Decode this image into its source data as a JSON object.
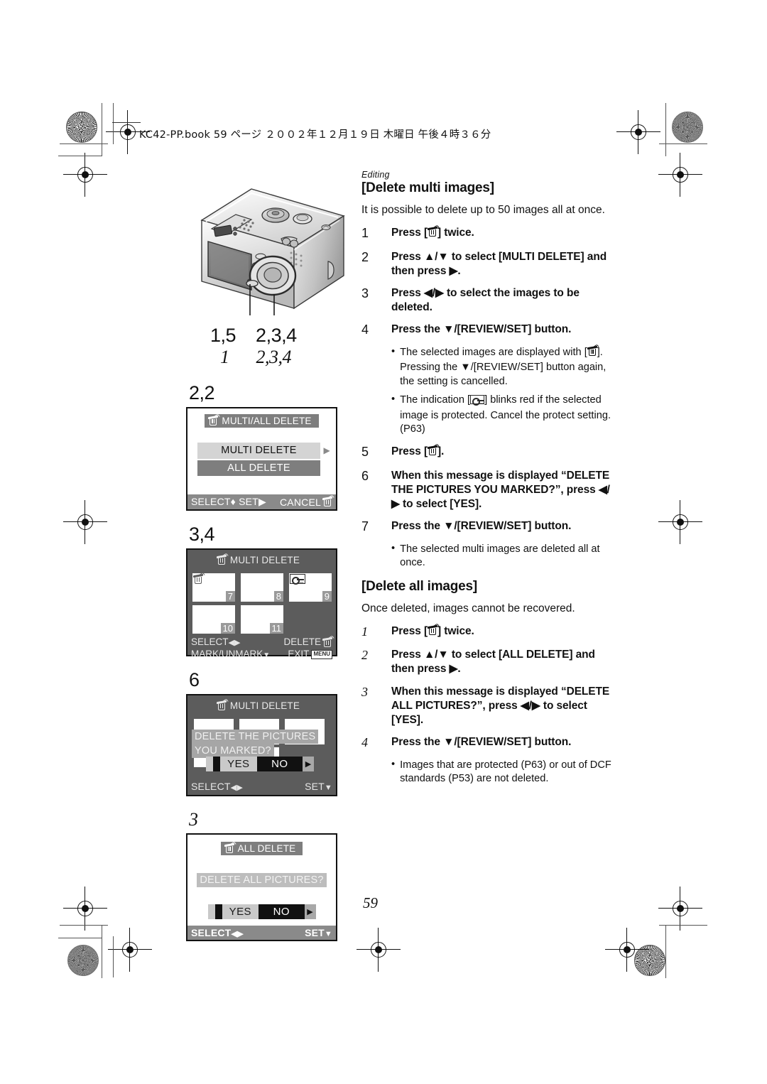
{
  "header": {
    "book_line": "KC42-PP.book  59 ページ  ２００２年１２月１９日  木曜日  午後４時３６分"
  },
  "page_number": "59",
  "left_column": {
    "camera_callouts": {
      "row1": [
        "1,5",
        "2,3,4"
      ],
      "row2": [
        "1",
        "2,3,4"
      ]
    },
    "screens": [
      {
        "step_label": "2,2",
        "title": "MULTI/ALL DELETE",
        "title_icon": "trash-icon",
        "style": "white",
        "menu": [
          {
            "label": "MULTI DELETE",
            "state": "selected",
            "caret": "▶"
          },
          {
            "label": "ALL DELETE",
            "state": "unselected",
            "caret": ""
          }
        ],
        "footer_left": "SELECT",
        "footer_left_icon": "updown-arrow-icon",
        "footer_mid": "SET",
        "footer_mid_icon": "▶",
        "footer_right": "CANCEL",
        "footer_right_icon": "trash-icon"
      },
      {
        "step_label": "3,4",
        "title": "MULTI DELETE",
        "title_icon": "trash-icon",
        "style": "dark",
        "thumbnails": [
          {
            "num": "7",
            "badge": "trash-icon"
          },
          {
            "num": "8",
            "badge": ""
          },
          {
            "num": "9",
            "badge": "key-icon"
          },
          {
            "num": "10",
            "badge": ""
          },
          {
            "num": "11",
            "badge": ""
          }
        ],
        "footer_rows": [
          {
            "left": "SELECT",
            "left_icon": "◀▶",
            "right": "DELETE",
            "right_icon": "trash-icon"
          },
          {
            "left": "MARK/UNMARK",
            "left_icon": "▼",
            "right": "EXIT",
            "right_icon": "MENU"
          }
        ]
      },
      {
        "step_label": "6",
        "title": "MULTI DELETE",
        "title_icon": "trash-icon",
        "style": "dark",
        "message_lines": [
          "DELETE THE PICTURES",
          "YOU MARKED?"
        ],
        "choices": {
          "yes": "YES",
          "no": "NO",
          "selected": "YES",
          "caret": "▶"
        },
        "footer_left": "SELECT",
        "footer_left_icon": "◀▶",
        "footer_right": "SET",
        "footer_right_icon": "▼"
      },
      {
        "step_label": "3",
        "step_label_italic": true,
        "title": "ALL DELETE",
        "title_icon": "trash-icon",
        "style": "white",
        "message_lines": [
          "DELETE ALL PICTURES?"
        ],
        "choices": {
          "yes": "YES",
          "no": "NO",
          "selected": "YES",
          "caret": "▶"
        },
        "footer_left": "SELECT",
        "footer_left_icon": "◀▶",
        "footer_right": "SET",
        "footer_right_icon": "▼"
      }
    ]
  },
  "right_column": {
    "kicker": "Editing",
    "section1": {
      "title": "[Delete multi images]",
      "intro": "It is possible to delete up to 50 images all at once.",
      "steps": [
        {
          "n": "1",
          "text_before": "Press [",
          "icon": "trash-icon",
          "text_after": "] twice."
        },
        {
          "n": "2",
          "text": "Press ▲/▼ to select [MULTI DELETE] and then press ▶."
        },
        {
          "n": "3",
          "text": "Press ◀/▶ to select the images to be deleted."
        },
        {
          "n": "4",
          "text": "Press the ▼/[REVIEW/SET] button."
        }
      ],
      "bullets_after_4": [
        {
          "part1": "The selected images are displayed with [",
          "icon": "trash-icon",
          "part2": "]. Pressing the ▼/[REVIEW/SET] button again, the setting is cancelled."
        },
        {
          "part1": "The indication [",
          "icon": "key-icon",
          "part2": "] blinks red if the selected image is protected. Cancel the protect setting. (P63)"
        }
      ],
      "steps2": [
        {
          "n": "5",
          "text_before": "Press [",
          "icon": "trash-icon",
          "text_after": "]."
        },
        {
          "n": "6",
          "text": "When this message is displayed “DELETE THE PICTURES YOU MARKED?”, press ◀/▶ to select [YES]."
        },
        {
          "n": "7",
          "text": "Press the ▼/[REVIEW/SET] button."
        }
      ],
      "bullets_after_7": [
        {
          "part1": "The selected multi images are deleted all at once.",
          "icon": "",
          "part2": ""
        }
      ]
    },
    "section2": {
      "title": "[Delete all images]",
      "intro": "Once deleted, images cannot be recovered.",
      "steps": [
        {
          "n": "1",
          "text_before": "Press [",
          "icon": "trash-icon",
          "text_after": "] twice."
        },
        {
          "n": "2",
          "text": "Press ▲/▼ to select [ALL DELETE] and then press ▶."
        },
        {
          "n": "3",
          "text": "When this message is displayed “DELETE ALL PICTURES?”, press ◀/▶ to select [YES]."
        },
        {
          "n": "4",
          "text": "Press the ▼/[REVIEW/SET] button."
        }
      ],
      "bullets": [
        {
          "part1": "Images that are protected (P63) or out of DCF standards (P53) are not deleted.",
          "icon": "",
          "part2": ""
        }
      ]
    }
  },
  "colors": {
    "lcd_dark_bg": "#5c5c5c",
    "lcd_title_bar": "#7e7e7e",
    "menu_selected": "#d4d4d4",
    "menu_unselected": "#7e7e7e",
    "footer_bar": "#8a8a8a",
    "message_bar": "#a6a6a6",
    "no_button": "#111111",
    "yes_button": "#c9c9c9"
  }
}
